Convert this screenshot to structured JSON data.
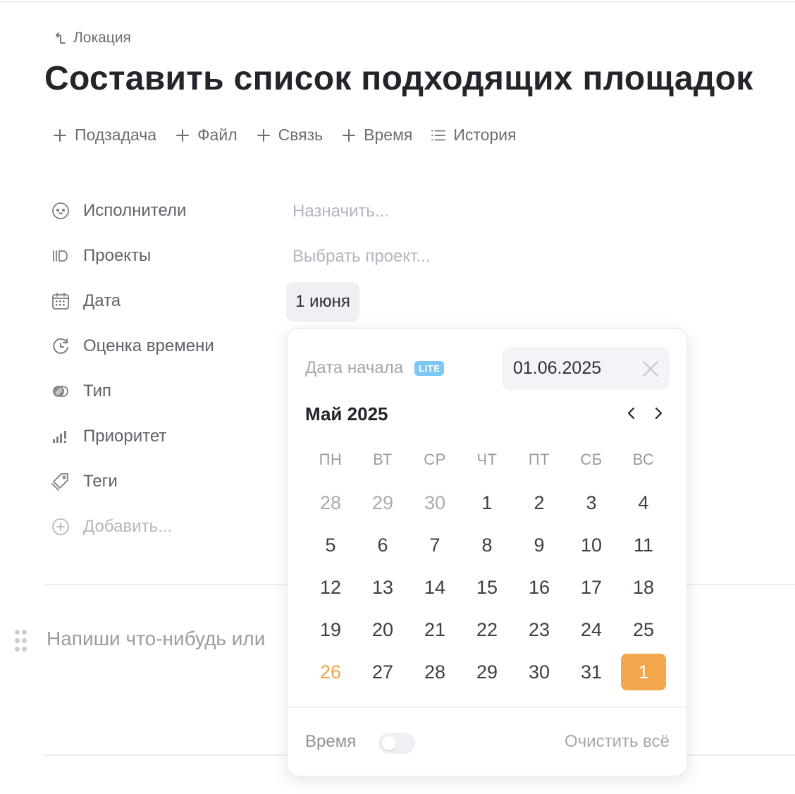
{
  "breadcrumb": {
    "parent_label": "Локация",
    "icon": "return-arrow-icon"
  },
  "task": {
    "title": "Составить список подходящих площадок"
  },
  "toolbar": {
    "subtask": "Подзадача",
    "file": "Файл",
    "link": "Связь",
    "time": "Время",
    "history": "История"
  },
  "properties": {
    "assignees": {
      "label": "Исполнители",
      "value": "Назначить...",
      "icon": "assignee-face-icon"
    },
    "projects": {
      "label": "Проекты",
      "value": "Выбрать проект...",
      "icon": "projects-icon"
    },
    "date": {
      "label": "Дата",
      "value": "1 июня",
      "icon": "calendar-icon"
    },
    "estimate": {
      "label": "Оценка времени",
      "icon": "estimate-refresh-icon"
    },
    "type": {
      "label": "Тип",
      "icon": "type-circles-icon"
    },
    "priority": {
      "label": "Приоритет",
      "icon": "priority-bars-icon"
    },
    "tags": {
      "label": "Теги",
      "icon": "tag-icon"
    },
    "add": {
      "label": "Добавить...",
      "icon": "plus-circle-icon"
    }
  },
  "editor": {
    "placeholder": "Напиши что-нибудь или"
  },
  "date_picker": {
    "start_label": "Дата начала",
    "badge": "LITE",
    "date_value": "01.06.2025",
    "month_title": "Май 2025",
    "weekdays": [
      "ПН",
      "ВТ",
      "СР",
      "ЧТ",
      "ПТ",
      "СБ",
      "ВС"
    ],
    "weeks": [
      [
        "28",
        "29",
        "30",
        "1",
        "2",
        "3",
        "4"
      ],
      [
        "5",
        "6",
        "7",
        "8",
        "9",
        "10",
        "11"
      ],
      [
        "12",
        "13",
        "14",
        "15",
        "16",
        "17",
        "18"
      ],
      [
        "19",
        "20",
        "21",
        "22",
        "23",
        "24",
        "25"
      ],
      [
        "26",
        "27",
        "28",
        "29",
        "30",
        "31",
        "1"
      ]
    ],
    "other_month_days": [
      [
        0,
        0
      ],
      [
        0,
        1
      ],
      [
        0,
        2
      ]
    ],
    "today": [
      4,
      0
    ],
    "selected": [
      4,
      6
    ],
    "time_label": "Время",
    "time_enabled": false,
    "clear_all": "Очистить всё"
  },
  "colors": {
    "accent": "#f4a74a",
    "today": "#f0a443",
    "badge": "#7cc8f4",
    "text_primary": "#23252b",
    "text_muted": "#b2b5bf"
  }
}
